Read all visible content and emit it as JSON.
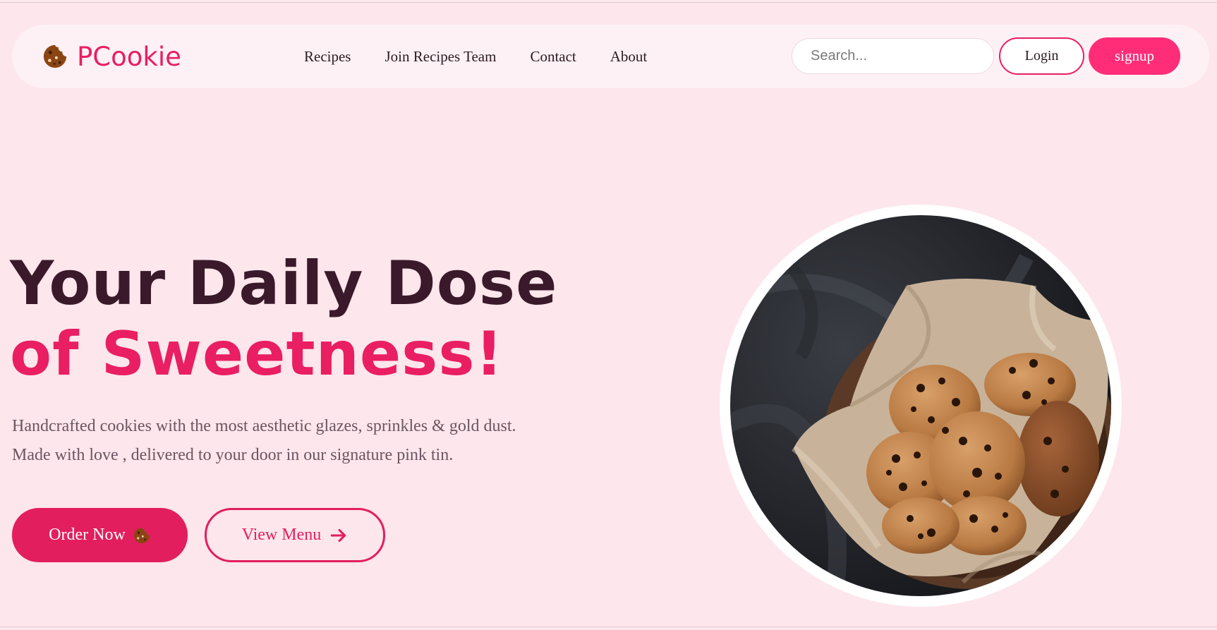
{
  "brand": {
    "name": "PCookie",
    "icon": "cookie-icon",
    "color": "#e91e63"
  },
  "nav": {
    "links": [
      {
        "label": "Recipes"
      },
      {
        "label": "Join Recipes Team"
      },
      {
        "label": "Contact"
      },
      {
        "label": "About"
      }
    ],
    "search": {
      "placeholder": "Search...",
      "value": ""
    },
    "login_label": "Login",
    "signup_label": "signup"
  },
  "hero": {
    "title_line1": "Your Daily Dose",
    "title_line2": "of Sweetness!",
    "description": "Handcrafted cookies with the most aesthetic glazes, sprinkles & gold dust. Made with love , delivered to your door in our signature pink tin.",
    "order_label": "Order Now",
    "order_icon": "cookie-icon",
    "view_label": "View Menu",
    "view_icon": "arrow-right-icon",
    "image": "bowl-of-chocolate-chip-cookies"
  },
  "colors": {
    "background": "#fde6ec",
    "navbar": "#fef1f5",
    "accent": "#e91e63",
    "signup": "#ff2d78",
    "title_dark": "#3a1a2a"
  }
}
